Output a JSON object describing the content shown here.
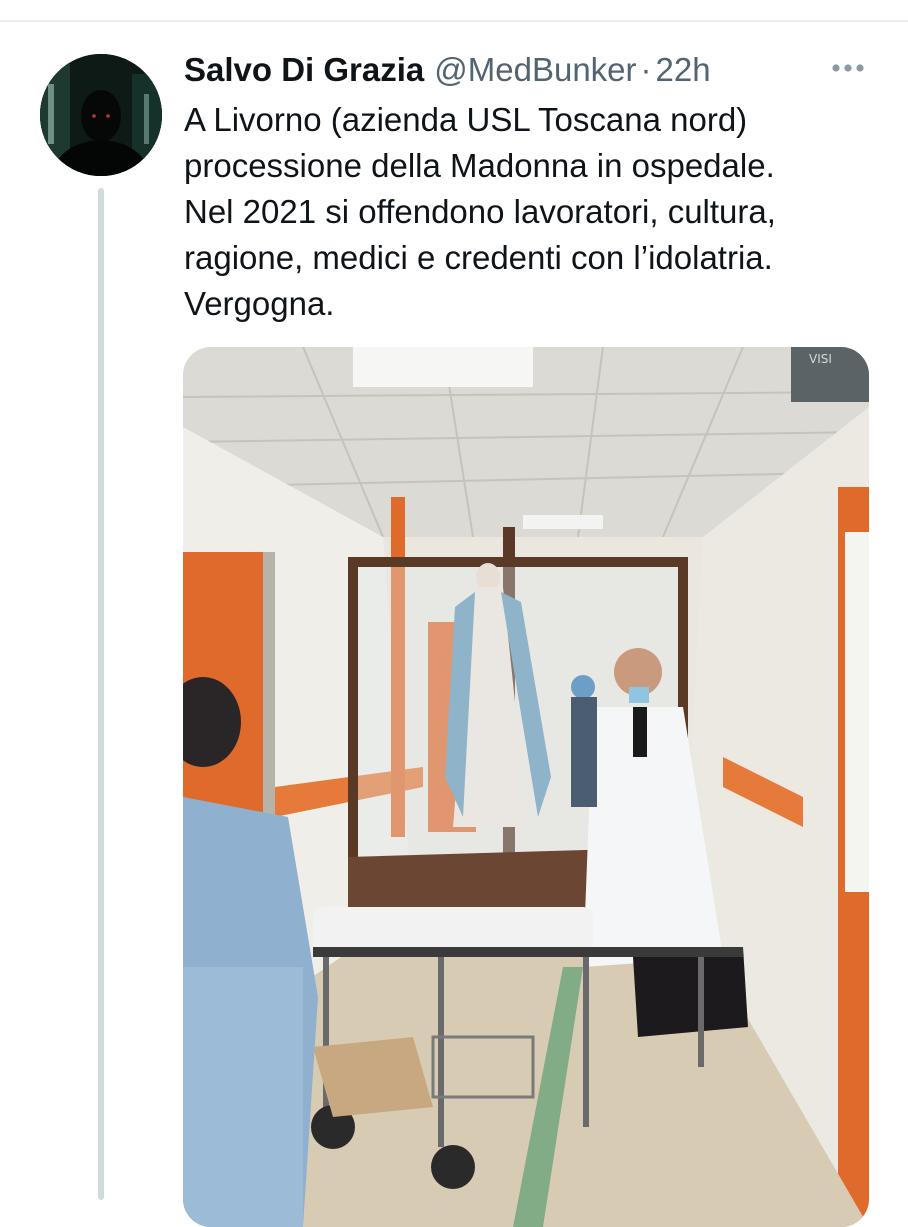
{
  "tweet": {
    "display_name": "Salvo Di Grazia",
    "handle": "@MedBunker",
    "separator": "·",
    "timestamp": "22h",
    "text_lines": [
      "A Livorno (azienda USL Toscana nord)",
      "processione della Madonna in ospedale.",
      "Nel 2021 si offendono lavoratori, cultura,",
      "ragione, medici e credenti con l’idolatria.",
      "Vergogna."
    ],
    "more_icon": "more-horizontal-icon"
  },
  "media": {
    "sign_text": "VISI"
  },
  "colors": {
    "text_primary": "#0f1419",
    "text_secondary": "#536471",
    "thread_line": "#cfd9de",
    "hospital_orange": "#e06a2b"
  }
}
